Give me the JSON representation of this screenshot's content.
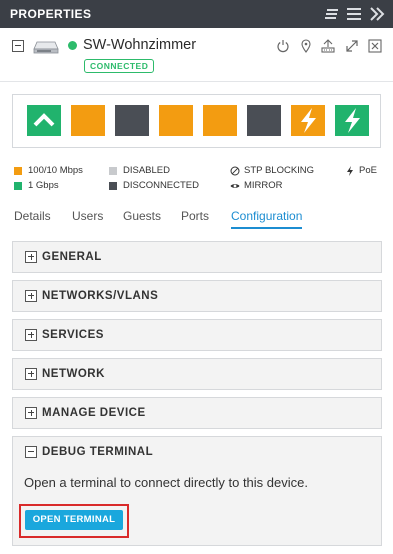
{
  "header": {
    "title": "PROPERTIES",
    "icons": [
      "list-alt-icon",
      "menu-icon",
      "collapse-double-chevron-icon"
    ]
  },
  "device": {
    "name": "SW-Wohnzimmer",
    "status": "CONNECTED",
    "status_color": "#2dbb6b",
    "actions": [
      "power-icon",
      "locate-icon",
      "network-topology-icon",
      "expand-icon",
      "close-icon"
    ]
  },
  "ports": [
    {
      "icon": "chevron-up-icon",
      "color": "#21b36d"
    },
    {
      "icon": "port-icon",
      "color": "#f39c11"
    },
    {
      "icon": "port-icon",
      "color": "#4a4e55"
    },
    {
      "icon": "port-icon",
      "color": "#f39c11"
    },
    {
      "icon": "port-icon",
      "color": "#f39c11"
    },
    {
      "icon": "port-icon",
      "color": "#4a4e55"
    },
    {
      "icon": "lightning-icon",
      "color": "#f39c11"
    },
    {
      "icon": "lightning-icon",
      "color": "#21b36d"
    }
  ],
  "legend": {
    "speed_100": "100/10 Mbps",
    "speed_1g": "1 Gbps",
    "disabled": "DISABLED",
    "disconnected": "DISCONNECTED",
    "stp": "STP BLOCKING",
    "mirror": "MIRROR",
    "poe": "PoE",
    "colors": {
      "orange": "#f39c11",
      "green": "#21b36d",
      "disabled": "#c8cacd",
      "disconnected": "#4a4e55"
    }
  },
  "tabs": {
    "details": "Details",
    "users": "Users",
    "guests": "Guests",
    "ports": "Ports",
    "configuration": "Configuration",
    "active": "Configuration"
  },
  "sections": {
    "general": "GENERAL",
    "networks_vlans": "NETWORKS/VLANS",
    "services": "SERVICES",
    "network": "NETWORK",
    "manage_device": "MANAGE DEVICE",
    "debug_terminal": "DEBUG TERMINAL",
    "debug_description": "Open a terminal to connect directly to this device.",
    "open_terminal_label": "OPEN TERMINAL",
    "accent": "#1aa7dd"
  }
}
